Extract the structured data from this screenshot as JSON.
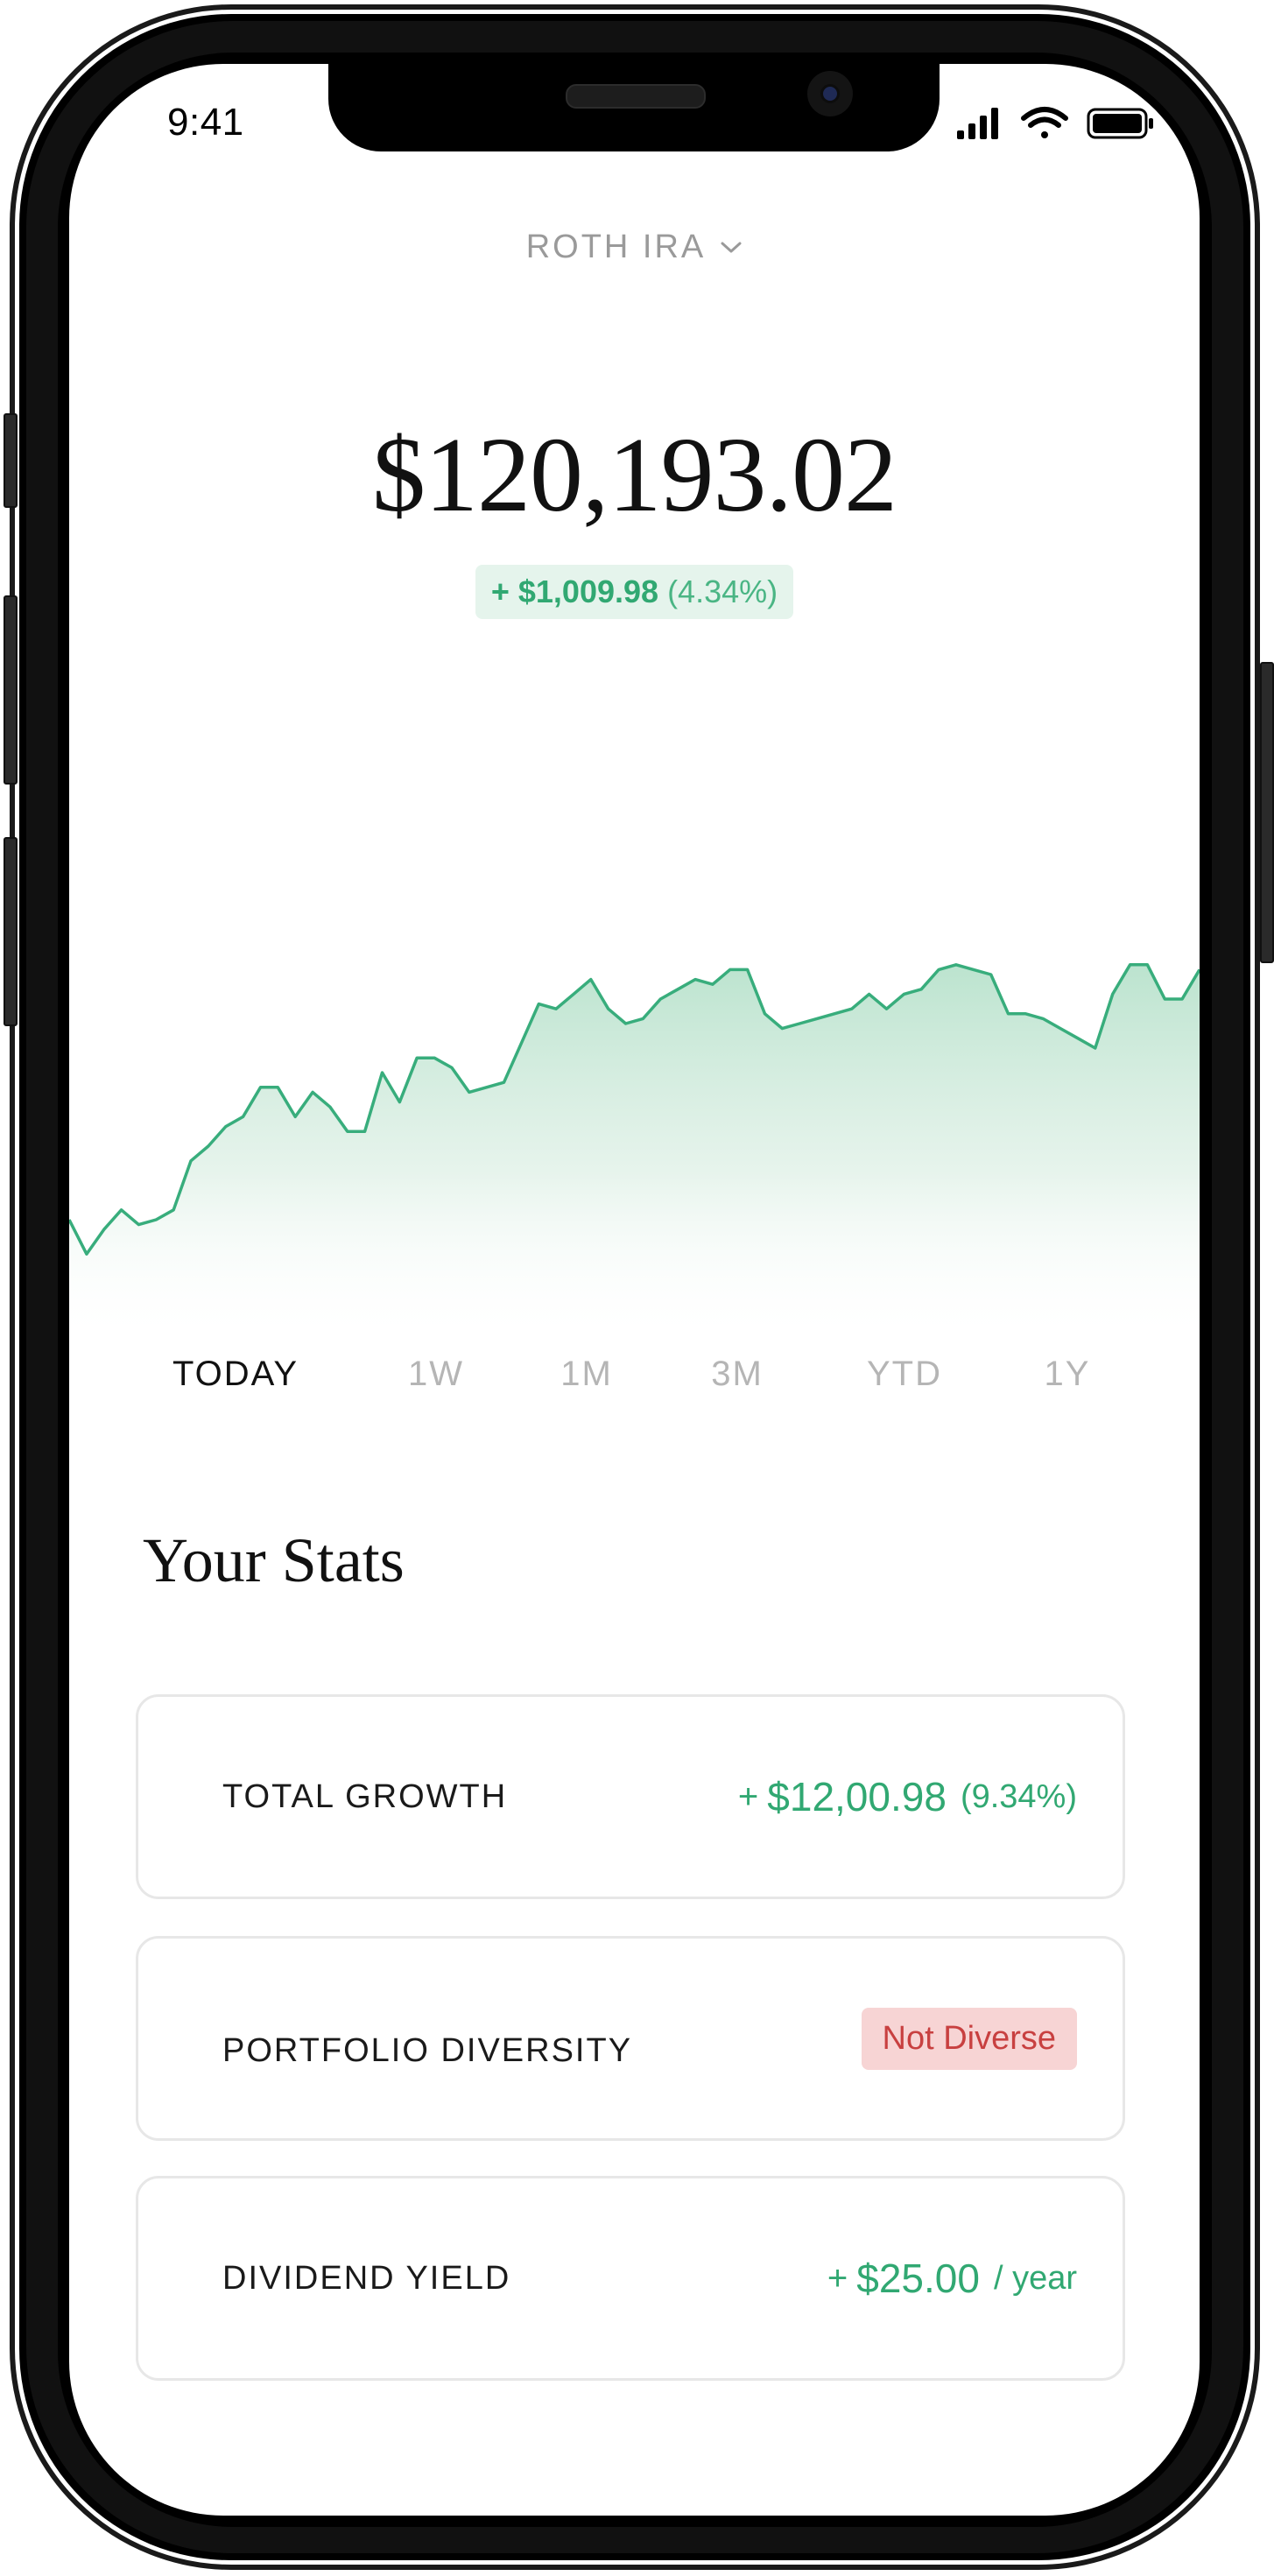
{
  "status_bar": {
    "time": "9:41",
    "icons": [
      "cellular-signal-icon",
      "wifi-icon",
      "battery-icon"
    ]
  },
  "account": {
    "label": "ROTH IRA",
    "icon": "chevron-down-icon"
  },
  "balance": {
    "value": "$120,193.02",
    "change_amount": "+ $1,009.98",
    "change_percent": "(4.34%)"
  },
  "colors": {
    "accent_green": "#31a872",
    "chart_fill": "#cdeadb",
    "danger_red": "#c84040",
    "danger_bg": "#f7d4d4"
  },
  "chart_data": {
    "type": "area",
    "title": "",
    "xlabel": "",
    "ylabel": "",
    "grid": false,
    "ylim": [
      0,
      100
    ],
    "values": [
      25,
      18,
      23,
      27,
      24,
      25,
      27,
      37,
      40,
      44,
      46,
      52,
      52,
      46,
      51,
      48,
      43,
      43,
      55,
      49,
      58,
      58,
      56,
      51,
      52,
      53,
      61,
      69,
      68,
      71,
      74,
      68,
      65,
      66,
      70,
      72,
      74,
      73,
      76,
      76,
      67,
      64,
      65,
      66,
      67,
      68,
      71,
      68,
      71,
      72,
      76,
      77,
      76,
      75,
      67,
      67,
      66,
      64,
      62,
      60,
      71,
      77,
      77,
      70,
      70,
      76
    ]
  },
  "ranges": [
    {
      "label": "TODAY",
      "active": true
    },
    {
      "label": "1W",
      "active": false
    },
    {
      "label": "1M",
      "active": false
    },
    {
      "label": "3M",
      "active": false
    },
    {
      "label": "YTD",
      "active": false
    },
    {
      "label": "1Y",
      "active": false
    }
  ],
  "stats": {
    "title": "Your Stats",
    "total_growth": {
      "label": "TOTAL GROWTH",
      "plus": "+",
      "value": "$12,00.98",
      "percent": "(9.34%)"
    },
    "diversity": {
      "label": "PORTFOLIO DIVERSITY",
      "badge": "Not Diverse"
    },
    "dividend": {
      "label": "DIVIDEND YIELD",
      "plus": "+",
      "value": "$25.00",
      "unit": "/ year"
    }
  }
}
